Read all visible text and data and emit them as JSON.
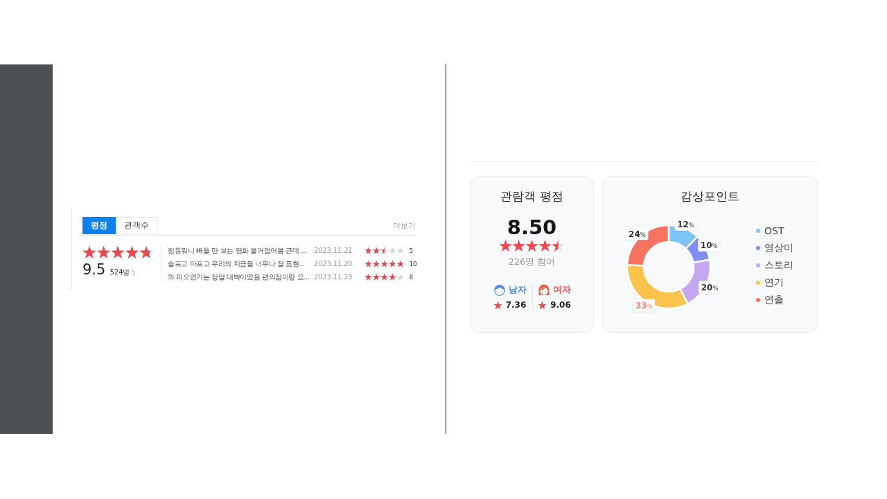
{
  "rating_widget": {
    "tabs": [
      {
        "label": "평점",
        "selected": true
      },
      {
        "label": "관객수",
        "selected": false
      }
    ],
    "more_link": "더보기",
    "summary": {
      "stars": 4.75,
      "score": "9.5",
      "count": "524명"
    },
    "reviews": [
      {
        "text": "정동워니 빠들 만 보는 영화 볼거없어봄 근데 ...",
        "date": "2023.11.21",
        "stars": 2.5,
        "score": "5"
      },
      {
        "text": "슬프고 아프고 우리의 지금을 너무나 잘 표현...",
        "date": "2023.11.20",
        "stars": 5,
        "score": "10"
      },
      {
        "text": "와 피오연기는 정말 대박이였음 편의점이랑 요...",
        "date": "2023.11.19",
        "stars": 4,
        "score": "8"
      }
    ]
  },
  "audience_rating": {
    "title": "관람객 평점",
    "score": "8.50",
    "stars": 4.5,
    "participants": "226명 참여",
    "genders": [
      {
        "kind": "male",
        "label": "남자",
        "score": "7.36"
      },
      {
        "kind": "female",
        "label": "여자",
        "score": "9.06"
      }
    ]
  },
  "viewing_points": {
    "title": "감상포인트",
    "chart_data": [
      {
        "type": "donut",
        "categories": [
          "OST",
          "영상미",
          "스토리",
          "연기",
          "연출"
        ],
        "values": [
          12,
          10,
          20,
          33,
          24
        ],
        "colors": [
          "#7cc3f8",
          "#7d8ff5",
          "#c3a7f3",
          "#fbc34c",
          "#f7735f"
        ],
        "data_labels": true,
        "value_labels": [
          "12%",
          "10%",
          "20%",
          "33%",
          "24%"
        ],
        "legend": "right"
      }
    ]
  }
}
